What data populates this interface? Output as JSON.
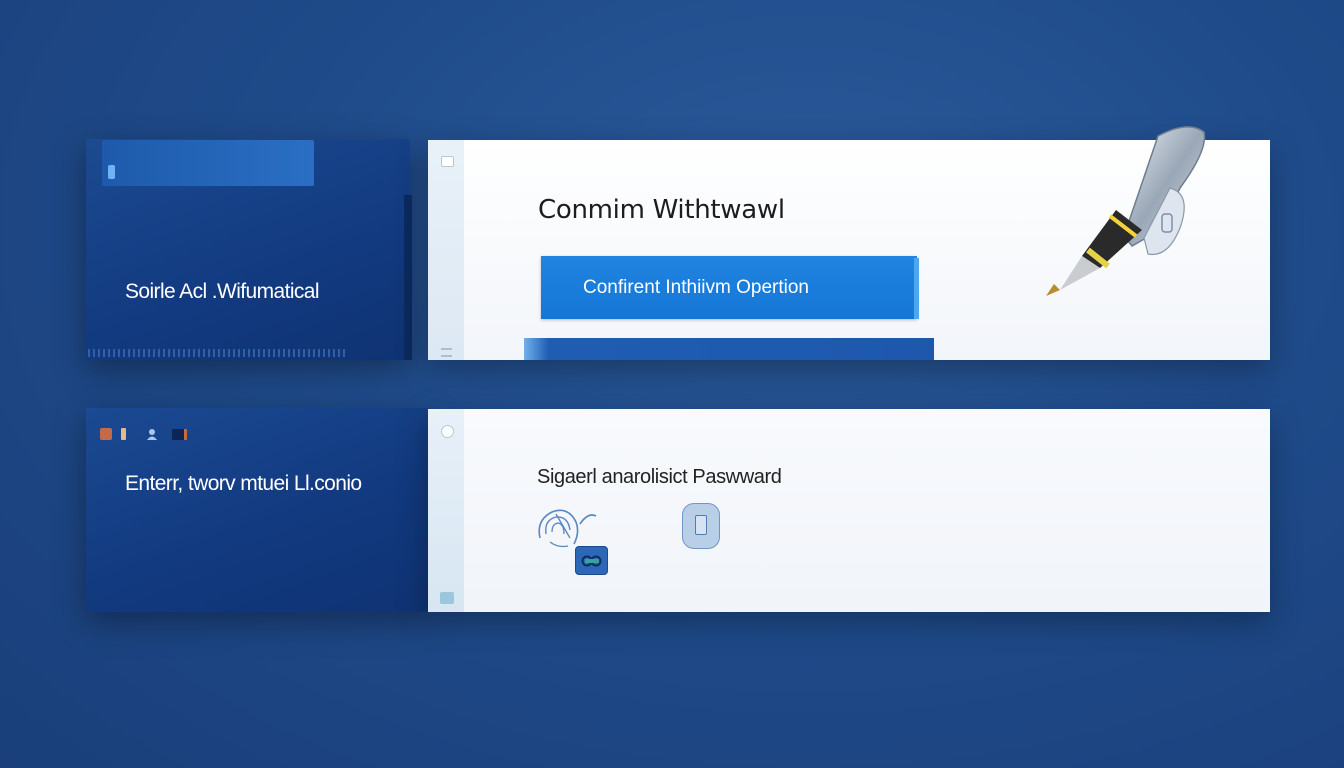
{
  "withdrawal_panel": {
    "sidebar_label": "Soirle Acl .Wifumatical",
    "title": "Conmim Withtwawl",
    "confirm_button_label": "Confirent Inthiivm Opertion"
  },
  "password_panel": {
    "sidebar_label": "Enterr, tworv mtuei Ll.conio",
    "title": "Sigaerl anarolisict Paswward"
  },
  "icons": {
    "pen": "pen-icon",
    "fingerprint": "fingerprint-icon",
    "secure_badge": "lock-badge-icon",
    "phone": "phone-icon"
  },
  "colors": {
    "background": "#1f4b8a",
    "panel_dark": "#123a80",
    "accent_button": "#1576d6",
    "panel_light": "#f2f5fa"
  }
}
